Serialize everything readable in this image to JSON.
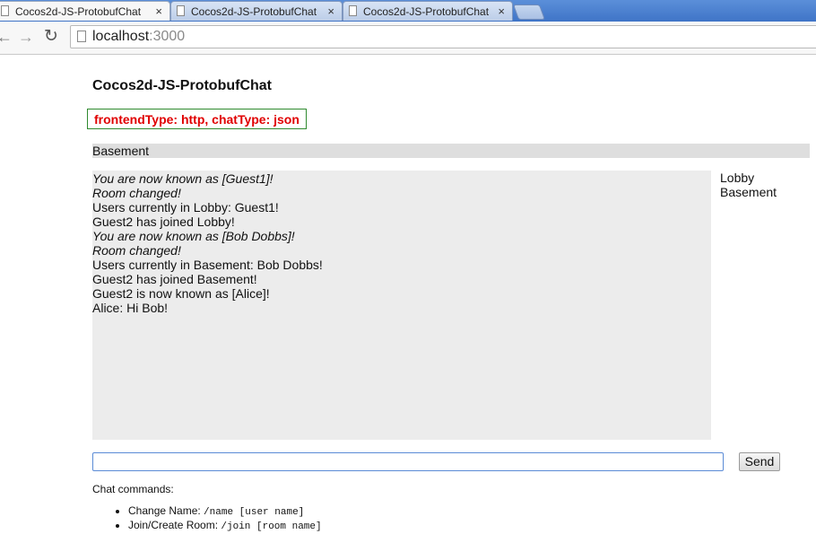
{
  "browser": {
    "tabs": [
      {
        "title": "Cocos2d-JS-ProtobufChat",
        "close": "×"
      },
      {
        "title": "Cocos2d-JS-ProtobufChat",
        "close": "×"
      },
      {
        "title": "Cocos2d-JS-ProtobufChat",
        "close": "×"
      }
    ],
    "nav": {
      "back": "←",
      "forward": "→",
      "reload": "↻"
    },
    "url_host": "localhost",
    "url_port": ":3000"
  },
  "page": {
    "title": "Cocos2d-JS-ProtobufChat",
    "type_info": "frontendType: http, chatType: json",
    "current_room": "Basement",
    "messages": [
      {
        "text": "You are now known as [Guest1]!"
      },
      {
        "text": "Room changed!"
      },
      {
        "text": "Users currently in Lobby: Guest1!"
      },
      {
        "text": "Guest2 has joined Lobby!"
      },
      {
        "text": "You are now known as [Bob Dobbs]!"
      },
      {
        "text": "Room changed!"
      },
      {
        "text": "Users currently in Basement: Bob Dobbs!"
      },
      {
        "text": "Guest2 has joined Basement!"
      },
      {
        "text": "Guest2 is now known as [Alice]!"
      },
      {
        "text": "Alice: Hi Bob!"
      }
    ],
    "rooms": [
      "Lobby",
      "Basement"
    ],
    "send_input_value": "",
    "send_label": "Send",
    "help": {
      "title": "Chat commands:",
      "commands": [
        {
          "label": "Change Name: ",
          "code": "/name [user name]"
        },
        {
          "label": "Join/Create Room: ",
          "code": "/join [room name]"
        }
      ]
    }
  }
}
